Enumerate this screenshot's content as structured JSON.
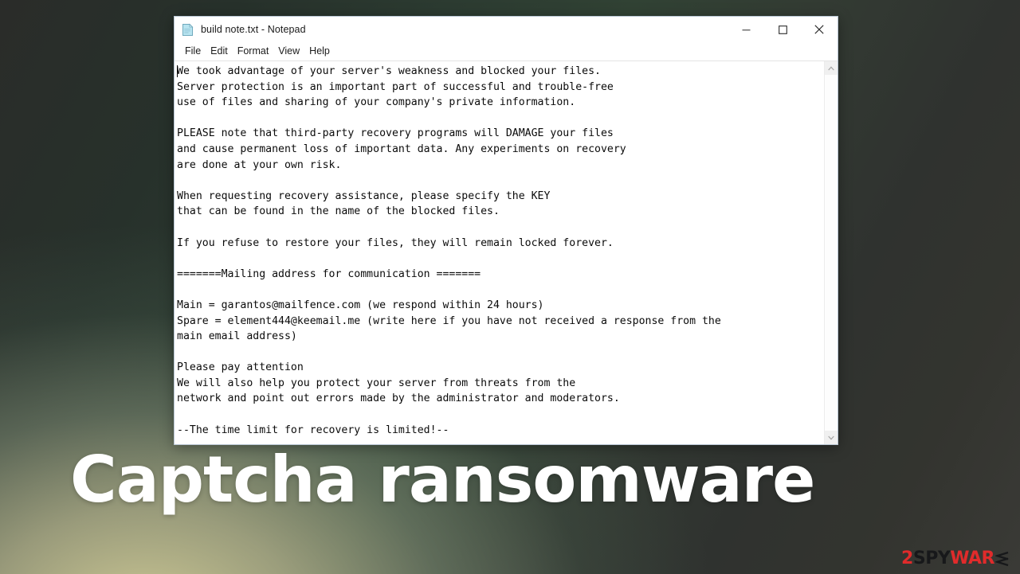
{
  "window": {
    "title": "build note.txt - Notepad",
    "icon": "notepad-document-icon",
    "menu": [
      "File",
      "Edit",
      "Format",
      "View",
      "Help"
    ],
    "controls": {
      "minimize": "minimize-icon",
      "maximize": "maximize-icon",
      "close": "close-icon"
    },
    "scrollbar": {
      "up": "chevron-up-icon",
      "down": "chevron-down-icon"
    }
  },
  "note": {
    "text": "We took advantage of your server's weakness and blocked your files.\nServer protection is an important part of successful and trouble-free\nuse of files and sharing of your company's private information.\n\nPLEASE note that third-party recovery programs will DAMAGE your files\nand cause permanent loss of important data. Any experiments on recovery\nare done at your own risk.\n\nWhen requesting recovery assistance, please specify the KEY\nthat can be found in the name of the blocked files.\n\nIf you refuse to restore your files, they will remain locked forever.\n\n=======Mailing address for communication =======\n\nMain = garantos@mailfence.com (we respond within 24 hours)\nSpare = element444@keemail.me (write here if you have not received a response from the\nmain email address)\n\nPlease pay attention\nWe will also help you protect your server from threats from the\nnetwork and point out errors made by the administrator and moderators.\n\n--The time limit for recovery is limited!--",
    "lines": [
      "We took advantage of your server's weakness and blocked your files.",
      "Server protection is an important part of successful and trouble-free",
      "use of files and sharing of your company's private information.",
      "",
      "PLEASE note that third-party recovery programs will DAMAGE your files",
      "and cause permanent loss of important data. Any experiments on recovery",
      "are done at your own risk.",
      "",
      "When requesting recovery assistance, please specify the KEY",
      "that can be found in the name of the blocked files.",
      "",
      "If you refuse to restore your files, they will remain locked forever.",
      "",
      "=======Mailing address for communication =======",
      "",
      "Main = garantos@mailfence.com (we respond within 24 hours)",
      "Spare = element444@keemail.me (write here if you have not received a response from the",
      "main email address)",
      "",
      "Please pay attention",
      "We will also help you protect your server from threats from the",
      "network and point out errors made by the administrator and moderators.",
      "",
      "--The time limit for recovery is limited!--"
    ],
    "contacts": {
      "main_email": "garantos@mailfence.com",
      "spare_email": "element444@keemail.me",
      "response_time": "24 hours"
    }
  },
  "headline": {
    "text": "Captcha ransomware"
  },
  "watermark": {
    "part1": "2",
    "part2": "SPY",
    "part3": "WAR",
    "part4": "chevron-e-icon",
    "full": "2SPYWARE"
  },
  "colors": {
    "accent_red": "#e02b2b",
    "watermark_dark": "#17181a",
    "headline": "#ffffff",
    "window_bg": "#ffffff",
    "window_border": "#b9c6d4"
  }
}
